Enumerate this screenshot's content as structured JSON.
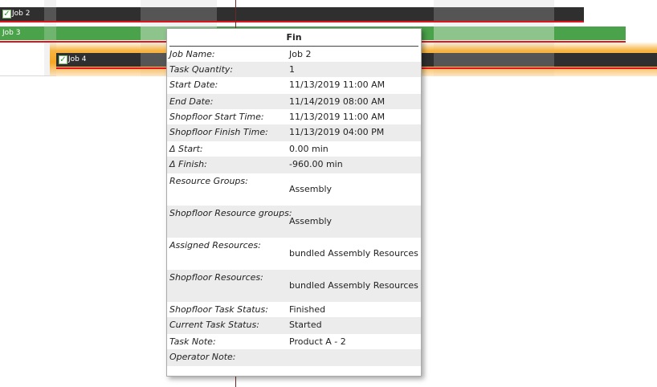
{
  "gantt": {
    "rows": [
      {
        "label": "Job 2",
        "checked": true,
        "color": "#333333"
      },
      {
        "label": "Job 3",
        "checked": false,
        "color": "#4aa24a"
      },
      {
        "label": "Job 4",
        "checked": true,
        "color": "#333333"
      }
    ],
    "highlight_color": "#f5a623",
    "red_line_color": "#e0151b"
  },
  "tooltip": {
    "title": "Fin",
    "rows": [
      {
        "key": "Job Name:",
        "value": "Job 2"
      },
      {
        "key": "Task Quantity:",
        "value": "1"
      },
      {
        "key": "Start Date:",
        "value": "11/13/2019 11:00 AM"
      },
      {
        "key": "End Date:",
        "value": "11/14/2019 08:00 AM"
      },
      {
        "key": "Shopfloor Start Time:",
        "value": "11/13/2019 11:00 AM"
      },
      {
        "key": "Shopfloor Finish Time:",
        "value": "11/13/2019 04:00 PM"
      },
      {
        "key": "Δ Start:",
        "value": "0.00 min"
      },
      {
        "key": "Δ Finish:",
        "value": "-960.00 min"
      },
      {
        "key": "Resource Groups:",
        "value": "Assembly"
      },
      {
        "key": "Shopfloor Resource groups:",
        "value": "Assembly"
      },
      {
        "key": "Assigned Resources:",
        "value": "bundled Assembly Resources"
      },
      {
        "key": "Shopfloor Resources:",
        "value": "bundled Assembly Resources"
      },
      {
        "key": "Shopfloor Task Status:",
        "value": "Finished"
      },
      {
        "key": "Current Task Status:",
        "value": "Started"
      },
      {
        "key": "Task Note:",
        "value": "Product A - 2"
      },
      {
        "key": "Operator Note:",
        "value": ""
      }
    ]
  }
}
